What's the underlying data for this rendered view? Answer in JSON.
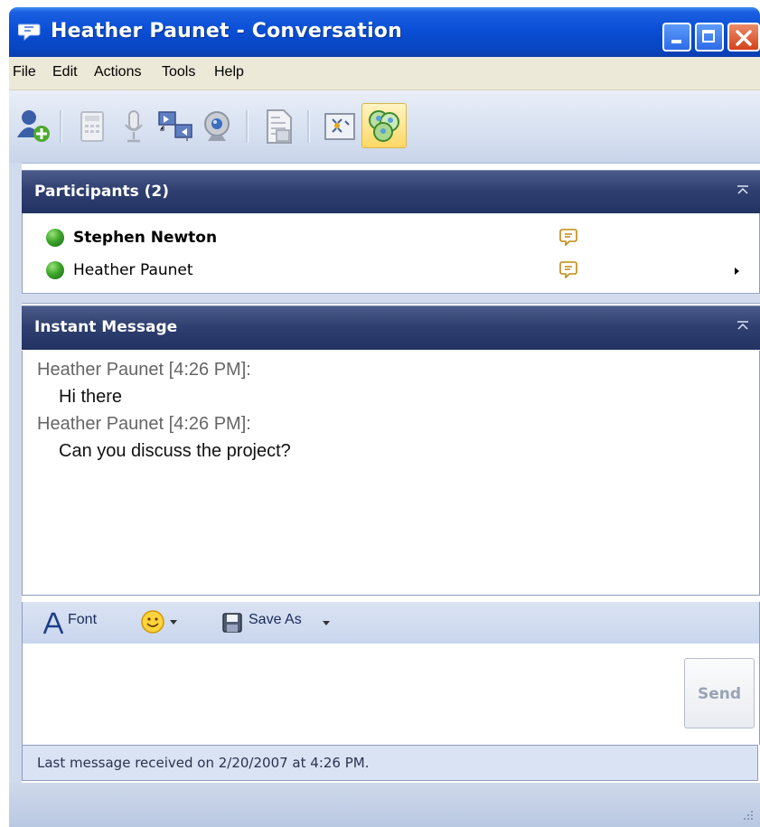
{
  "window": {
    "title": "Heather Paunet - Conversation",
    "controls": [
      "minimize-icon",
      "maximize-icon",
      "close-icon"
    ]
  },
  "menu": {
    "items": [
      "File",
      "Edit",
      "Actions",
      "Tools",
      "Help"
    ]
  },
  "toolbar": {
    "buttons": [
      {
        "icon": "add-participant-icon",
        "enabled": true
      },
      {
        "icon": "phone-dialpad-icon",
        "enabled": false
      },
      {
        "icon": "microphone-icon",
        "enabled": false
      },
      {
        "icon": "share-desktop-icon",
        "enabled": false
      },
      {
        "icon": "webcam-icon",
        "enabled": false
      },
      {
        "icon": "send-file-icon",
        "enabled": false
      },
      {
        "icon": "whiteboard-icon",
        "enabled": false
      },
      {
        "icon": "conversation-bubbles-icon",
        "enabled": true,
        "active": true
      }
    ]
  },
  "participants": {
    "title": "Participants (2)",
    "people": [
      {
        "name": "Stephen Newton",
        "bold": true,
        "status_color": "#3da52a"
      },
      {
        "name": "Heather Paunet",
        "bold": false,
        "status_color": "#3da52a"
      }
    ]
  },
  "im": {
    "title": "Instant Message",
    "messages": [
      {
        "sender": "Heather Paunet [4:26 PM]:",
        "text": "Hi there"
      },
      {
        "sender": "Heather Paunet [4:26 PM]:",
        "text": "Can you discuss the project?"
      }
    ]
  },
  "format": {
    "font_label": "Font",
    "save_label": "Save As"
  },
  "compose": {
    "value": "",
    "send_label": "Send"
  },
  "status": {
    "text": "Last message received on 2/20/2007 at 4:26 PM."
  },
  "colors": {
    "titlebar": "#0a4fd6",
    "section_header": "#2f3f6f",
    "presence_online": "#3da52a"
  }
}
